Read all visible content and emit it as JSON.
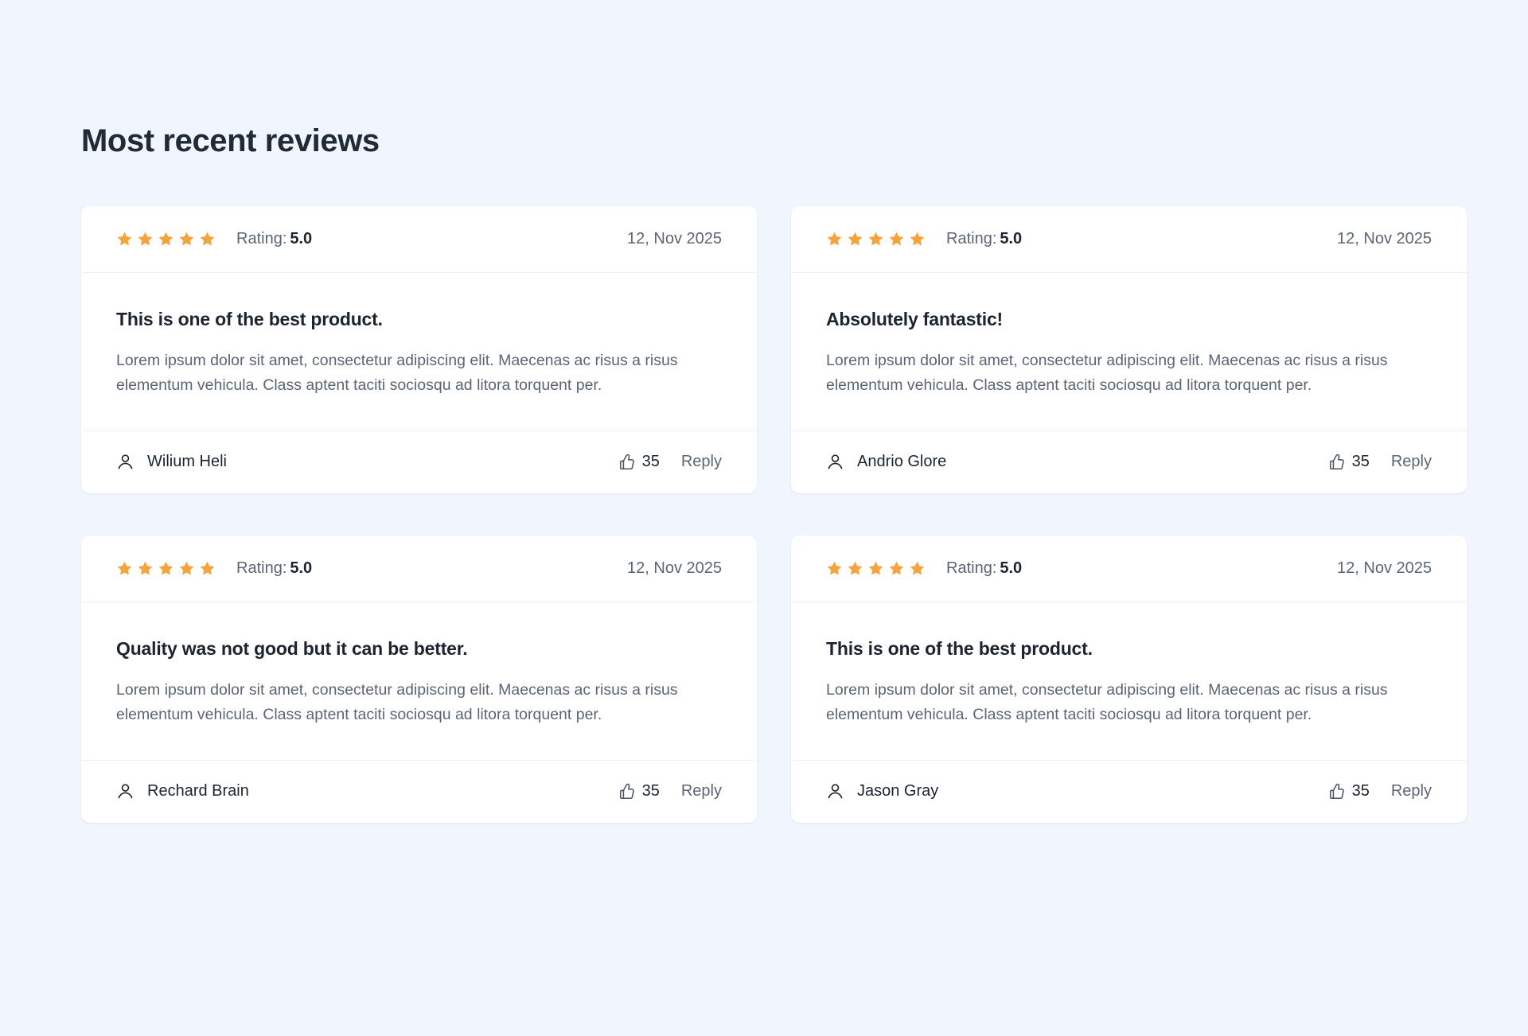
{
  "page": {
    "title": "Most recent reviews",
    "background_color": "#f1f5fe",
    "star_color": "#f5a33f",
    "card_color": "#ffffff"
  },
  "icons": {
    "star": "star-icon",
    "person": "person-icon",
    "thumbs_up": "thumbs-up-icon"
  },
  "labels": {
    "rating_prefix": "Rating:",
    "reply": "Reply"
  },
  "reviews": [
    {
      "stars": 5,
      "rating_value": "5.0",
      "date": "12, Nov 2025",
      "title": "This is one of the best product.",
      "text": "Lorem ipsum dolor sit amet, consectetur adipiscing elit. Maecenas ac risus a risus elementum vehicula. Class aptent taciti sociosqu ad litora torquent per.",
      "author": "Wilium Heli",
      "likes": "35",
      "reply": "Reply"
    },
    {
      "stars": 5,
      "rating_value": "5.0",
      "date": "12, Nov 2025",
      "title": "Absolutely fantastic!",
      "text": "Lorem ipsum dolor sit amet, consectetur adipiscing elit. Maecenas ac risus a risus elementum vehicula. Class aptent taciti sociosqu ad litora torquent per.",
      "author": "Andrio Glore",
      "likes": "35",
      "reply": "Reply"
    },
    {
      "stars": 5,
      "rating_value": "5.0",
      "date": "12, Nov 2025",
      "title": "Quality was not good but it can be better.",
      "text": "Lorem ipsum dolor sit amet, consectetur adipiscing elit. Maecenas ac risus a risus elementum vehicula. Class aptent taciti sociosqu ad litora torquent per.",
      "author": "Rechard Brain",
      "likes": "35",
      "reply": "Reply"
    },
    {
      "stars": 5,
      "rating_value": "5.0",
      "date": "12, Nov 2025",
      "title": "This is one of the best product.",
      "text": "Lorem ipsum dolor sit amet, consectetur adipiscing elit. Maecenas ac risus a risus elementum vehicula. Class aptent taciti sociosqu ad litora torquent per.",
      "author": "Jason Gray",
      "likes": "35",
      "reply": "Reply"
    }
  ]
}
